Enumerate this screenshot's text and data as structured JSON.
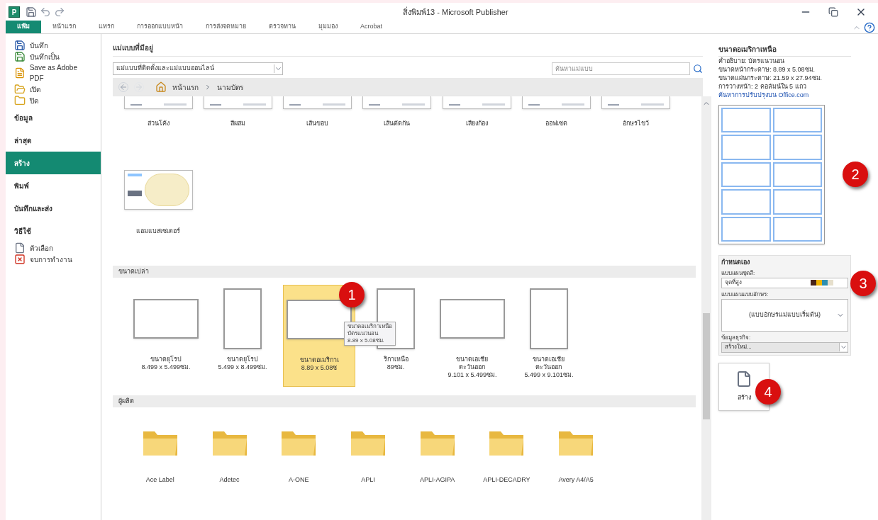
{
  "window": {
    "app_letter": "P",
    "title": "สิ่งพิมพ์13 - Microsoft Publisher"
  },
  "ribbon_tabs": [
    {
      "label": "แฟ้ม",
      "selected": true
    },
    {
      "label": "หน้าแรก",
      "selected": false
    },
    {
      "label": "แทรก",
      "selected": false
    },
    {
      "label": "การออกแบบหน้า",
      "selected": false
    },
    {
      "label": "การส่งจดหมาย",
      "selected": false
    },
    {
      "label": "ตรวจทาน",
      "selected": false
    },
    {
      "label": "มุมมอง",
      "selected": false
    },
    {
      "label": "Acrobat",
      "selected": false
    }
  ],
  "backstage_menu": [
    {
      "label": "บันทึก",
      "kind": "save",
      "selected": false
    },
    {
      "label": "บันทึกเป็น",
      "kind": "saveas",
      "selected": false
    },
    {
      "label": "Save as Adobe PDF",
      "kind": "pdf",
      "selected": false
    },
    {
      "label": "เปิด",
      "kind": "open",
      "selected": false
    },
    {
      "label": "ปิด",
      "kind": "close",
      "selected": false
    },
    {
      "label": "ข้อมูล",
      "kind": "page",
      "selected": false
    },
    {
      "label": "ล่าสุด",
      "kind": "page",
      "selected": false
    },
    {
      "label": "สร้าง",
      "kind": "page",
      "selected": true
    },
    {
      "label": "พิมพ์",
      "kind": "page",
      "selected": false
    },
    {
      "label": "บันทึกและส่ง",
      "kind": "page",
      "selected": false
    },
    {
      "label": "วิธีใช้",
      "kind": "page",
      "selected": false
    },
    {
      "label": "ตัวเลือก",
      "kind": "options",
      "selected": false
    },
    {
      "label": "จบการทำงาน",
      "kind": "exit",
      "selected": false
    }
  ],
  "main": {
    "heading": "แม่แบบที่มีอยู่",
    "source": "แม่แบบที่ติดตั้งและแม่แบบออนไลน์",
    "search": {
      "placeholder": "ค้นหาแม่แบบ"
    },
    "breadcrumb": [
      "หน้าแรก",
      "นามบัตร"
    ],
    "designs": [
      {
        "label": "ส่วนโค้ง",
        "kind": "cut"
      },
      {
        "label": "สีผสม",
        "kind": "cut"
      },
      {
        "label": "เส้นขอบ",
        "kind": "cut"
      },
      {
        "label": "เส้นตัดกัน",
        "kind": "cut"
      },
      {
        "label": "เสียงก้อง",
        "kind": "cut"
      },
      {
        "label": "ออฟเซต",
        "kind": "cut"
      },
      {
        "label": "อักษรไขว้",
        "kind": "cut"
      },
      {
        "label": "แอมแบสเซเดอร์",
        "kind": "full"
      }
    ],
    "blank_sizes": {
      "heading": "ขนาดเปล่า",
      "items": [
        {
          "lines": [
            "ขนาดยุโรป",
            "8.499 x 5.499ซม."
          ],
          "kind": "landscape",
          "selected": false
        },
        {
          "lines": [
            "ขนาดยุโรป",
            "5.499 x 8.499ซม."
          ],
          "kind": "portrait",
          "selected": false
        },
        {
          "lines": [
            "ขนาดอเมริกาเ",
            "8.89 x 5.08ซ"
          ],
          "kind": "landscape",
          "selected": true
        },
        {
          "lines": [
            "ริกาเหนือ",
            "89ซม."
          ],
          "kind": "portrait",
          "selected": false
        },
        {
          "lines": [
            "ขนาดเอเชีย",
            "ตะวันออก",
            "9.101 x 5.499ซม."
          ],
          "kind": "landscape",
          "selected": false
        },
        {
          "lines": [
            "ขนาดเอเชีย",
            "ตะวันออก",
            "5.499 x 9.101ซม."
          ],
          "kind": "portrait",
          "selected": false
        }
      ],
      "tooltip": [
        "ขนาดอเมริกาเหนือ",
        "บัตรแนวนอน",
        "8.89 x 5.08ซม."
      ]
    },
    "manufacturers": {
      "heading": "ผู้ผลิต",
      "items": [
        "Ace Label",
        "Adetec",
        "A-ONE",
        "APLI",
        "APLI-AGIPA",
        "APLI-DECADRY",
        "Avery A4/A5"
      ]
    }
  },
  "details": {
    "title": "ขนาดอเมริกาเหนือ",
    "lines": [
      "คำอธิบาย: บัตรแนวนอน",
      "ขนาดหน้ากระดาษ: 8.89 x 5.08ซม.",
      "ขนาดแผ่นกระดาษ: 21.59 x 27.94ซม.",
      "การวางหน้า: 2 คอลัมน์ใน 5 แถว"
    ],
    "link": "ค้นหาการปรับปรุงบน Office.com"
  },
  "customize": {
    "heading": "กำหนดเอง",
    "color_scheme_label": "แบบแผนชุดสี:",
    "color_scheme": "จุดที่สูง",
    "swatches": [
      {
        "color": "#4a2418"
      },
      {
        "color": "#f0b400"
      },
      {
        "color": "#2d8fb0"
      },
      {
        "color": "#e6dfcc"
      }
    ],
    "font_scheme_label": "แบบแผนแบบอักษร:",
    "font_scheme": "(แบบอักษรแม่แบบเริ่มต้น)",
    "business_label": "ข้อมูลธุรกิจ:",
    "business": "สร้างใหม่..."
  },
  "create_button": "สร้าง",
  "callouts": [
    "1",
    "2",
    "3",
    "4"
  ]
}
